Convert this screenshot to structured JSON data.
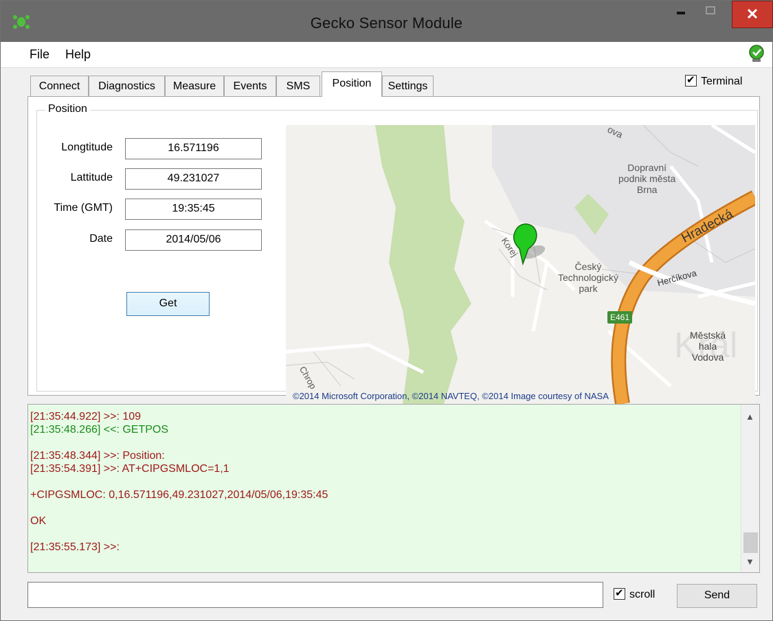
{
  "window": {
    "title": "Gecko Sensor Module",
    "close_glyph": "✕"
  },
  "menu": {
    "items": [
      {
        "label": "File"
      },
      {
        "label": "Help"
      }
    ]
  },
  "tabs": [
    {
      "label": "Connect"
    },
    {
      "label": "Diagnostics"
    },
    {
      "label": "Measure"
    },
    {
      "label": "Events"
    },
    {
      "label": "SMS"
    },
    {
      "label": "Position",
      "active": true
    },
    {
      "label": "Settings"
    }
  ],
  "terminal_toggle": {
    "label": "Terminal",
    "checked": true
  },
  "position_group": {
    "title": "Position",
    "fields": {
      "longitude": {
        "label": "Longtitude",
        "value": "16.571196"
      },
      "latitude": {
        "label": "Lattitude",
        "value": "49.231027"
      },
      "time": {
        "label": "Time (GMT)",
        "value": "19:35:45"
      },
      "date": {
        "label": "Date",
        "value": "2014/05/06"
      }
    },
    "get_button": "Get"
  },
  "map": {
    "labels": {
      "road_top": "ova",
      "dpmb": "Dopravní\npodnik města\nBrna",
      "hradecka": "Hradecká",
      "korejska": "Korej",
      "hercikova": "Herčíkova",
      "tech_park": "Český\nTechnologický\npark",
      "road_badge": "E461",
      "hala": "Městská\nhala\nVodova",
      "bg_watermark": "Král",
      "chrop": "Chrop"
    },
    "copyright": "©2014 Microsoft Corporation, ©2014 NAVTEQ, ©2014 Image courtesy of NASA",
    "colors": {
      "park": "#c8dfae",
      "highway": "#f0a23c",
      "pin": "#22c91f"
    }
  },
  "terminal": {
    "lines": [
      {
        "text": "[21:35:44.922] >>: 109",
        "kind": "out"
      },
      {
        "text": "[21:35:48.266] <<: GETPOS",
        "kind": "in"
      },
      {
        "text": "",
        "kind": "out"
      },
      {
        "text": "[21:35:48.344] >>: Position:",
        "kind": "out"
      },
      {
        "text": "[21:35:54.391] >>: AT+CIPGSMLOC=1,1",
        "kind": "out"
      },
      {
        "text": "",
        "kind": "out"
      },
      {
        "text": "+CIPGSMLOC: 0,16.571196,49.231027,2014/05/06,19:35:45",
        "kind": "out"
      },
      {
        "text": "",
        "kind": "out"
      },
      {
        "text": "OK",
        "kind": "out"
      },
      {
        "text": "",
        "kind": "out"
      },
      {
        "text": "[21:35:55.173] >>:",
        "kind": "out"
      }
    ]
  },
  "bottom": {
    "input_value": "",
    "scroll": {
      "label": "scroll",
      "checked": true
    },
    "send_label": "Send"
  }
}
